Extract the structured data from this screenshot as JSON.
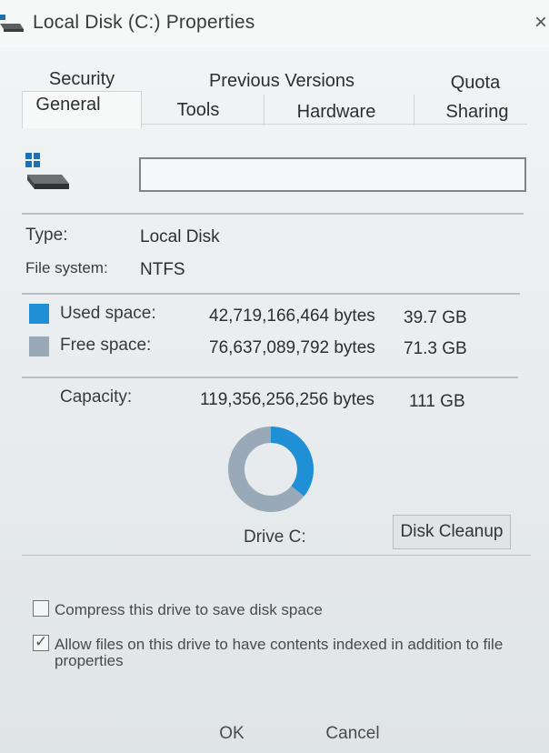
{
  "window": {
    "title": "Local Disk (C:) Properties",
    "close_glyph": "×",
    "icon": "drive-icon"
  },
  "tabs": {
    "row1": [
      "Security",
      "Previous Versions",
      "Quota"
    ],
    "row2": [
      "General",
      "Tools",
      "Hardware",
      "Sharing"
    ],
    "active": "General"
  },
  "general": {
    "name_value": "",
    "type_label": "Type:",
    "type_value": "Local Disk",
    "fs_label": "File system:",
    "fs_value": "NTFS",
    "used": {
      "label": "Used space:",
      "bytes": "42,719,166,464 bytes",
      "human": "39.7 GB",
      "color": "#1f8fd6"
    },
    "free": {
      "label": "Free space:",
      "bytes": "76,637,089,792 bytes",
      "human": "71.3 GB",
      "color": "#9aa9b8"
    },
    "capacity": {
      "label": "Capacity:",
      "bytes": "119,356,256,256 bytes",
      "human": "111 GB"
    },
    "drive_label": "Drive C:",
    "cleanup_button": "Disk Cleanup",
    "used_fraction": 0.358,
    "compress": {
      "label": "Compress this drive to save disk space",
      "checked": false
    },
    "index": {
      "label": "Allow files on this drive to have contents indexed in addition to file properties",
      "checked": true
    }
  },
  "footer": {
    "ok": "OK",
    "cancel": "Cancel"
  }
}
